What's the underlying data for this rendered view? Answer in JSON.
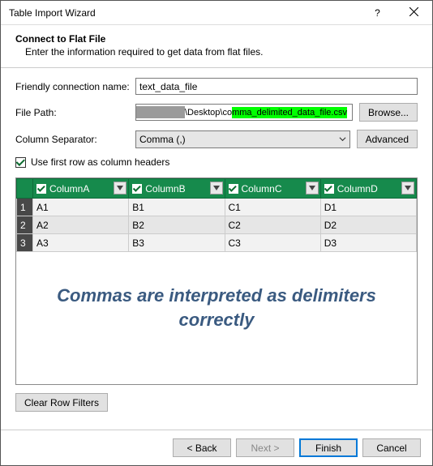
{
  "window": {
    "title": "Table Import Wizard"
  },
  "header": {
    "title": "Connect to Flat File",
    "subtitle": "Enter the information required to get data from flat files."
  },
  "form": {
    "friendly_name_label": "Friendly connection name:",
    "friendly_name_value": "text_data_file",
    "file_path_label": "File Path:",
    "file_path_prefix": "\\Desktop\\co",
    "file_path_highlight": "mma_delimited_data_file.csv",
    "browse_label": "Browse...",
    "column_separator_label": "Column Separator:",
    "column_separator_value": "Comma (,)",
    "advanced_label": "Advanced",
    "use_first_row_label": "Use first row as column headers",
    "use_first_row_checked": true
  },
  "grid": {
    "columns": [
      "ColumnA",
      "ColumnB",
      "ColumnC",
      "ColumnD"
    ],
    "rows": [
      [
        "A1",
        "B1",
        "C1",
        "D1"
      ],
      [
        "A2",
        "B2",
        "C2",
        "D2"
      ],
      [
        "A3",
        "B3",
        "C3",
        "D3"
      ]
    ]
  },
  "annotation": {
    "text": "Commas are interpreted as delimiters correctly"
  },
  "buttons": {
    "clear_filters": "Clear Row Filters",
    "back": "< Back",
    "next": "Next >",
    "finish": "Finish",
    "cancel": "Cancel"
  }
}
